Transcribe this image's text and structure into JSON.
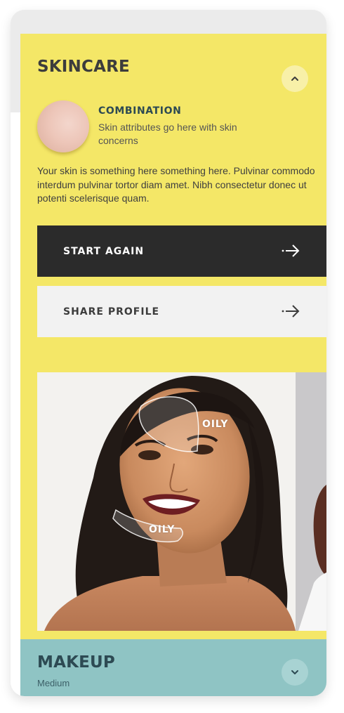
{
  "skincare": {
    "title": "SKINCARE",
    "toggle_icon": "chevron-up-icon",
    "skin_type": "COMBINATION",
    "skin_attributes": "Skin attributes go here with skin concerns",
    "description": "Your skin is something here something here. Pulvinar commodo interdum pulvinar tortor diam amet. Nibh consectetur donec ut potenti scelerisque quam.",
    "buttons": {
      "start_again": "START AGAIN",
      "share_profile": "SHARE PROFILE"
    },
    "zones": [
      "OILY",
      "OILY"
    ]
  },
  "makeup": {
    "title": "MAKEUP",
    "subtitle": "Medium",
    "toggle_icon": "chevron-down-icon"
  },
  "colors": {
    "skincare_bg": "#f4e767",
    "makeup_bg": "#8fc4c4",
    "dark_button": "#2b2b2b",
    "light_button": "#f2f2f2",
    "heading_teal": "#2d4a53"
  }
}
